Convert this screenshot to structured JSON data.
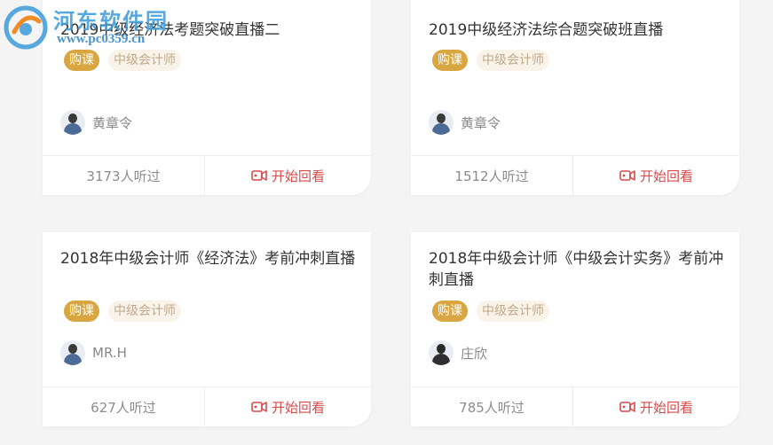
{
  "watermark": {
    "name": "河东软件园",
    "url": "www.pc0359.cn"
  },
  "cards": [
    {
      "title": "2019中级经济法考题突破直播二",
      "tag_buy": "购课",
      "tag_category": "中级会计师",
      "teacher": "黄章令",
      "listens": "3173人听过",
      "action": "开始回看"
    },
    {
      "title": "2019中级经济法综合题突破班直播",
      "tag_buy": "购课",
      "tag_category": "中级会计师",
      "teacher": "黄章令",
      "listens": "1512人听过",
      "action": "开始回看"
    },
    {
      "title": "2018年中级会计师《经济法》考前冲刺直播",
      "tag_buy": "购课",
      "tag_category": "中级会计师",
      "teacher": "MR.H",
      "listens": "627人听过",
      "action": "开始回看"
    },
    {
      "title": "2018年中级会计师《中级会计实务》考前冲刺直播",
      "tag_buy": "购课",
      "tag_category": "中级会计师",
      "teacher": "庄欣",
      "listens": "785人听过",
      "action": "开始回看"
    }
  ],
  "colors": {
    "buy_tag": "#d9a742",
    "category_tag_bg": "#faf3ea",
    "replay": "#d94a4a"
  }
}
